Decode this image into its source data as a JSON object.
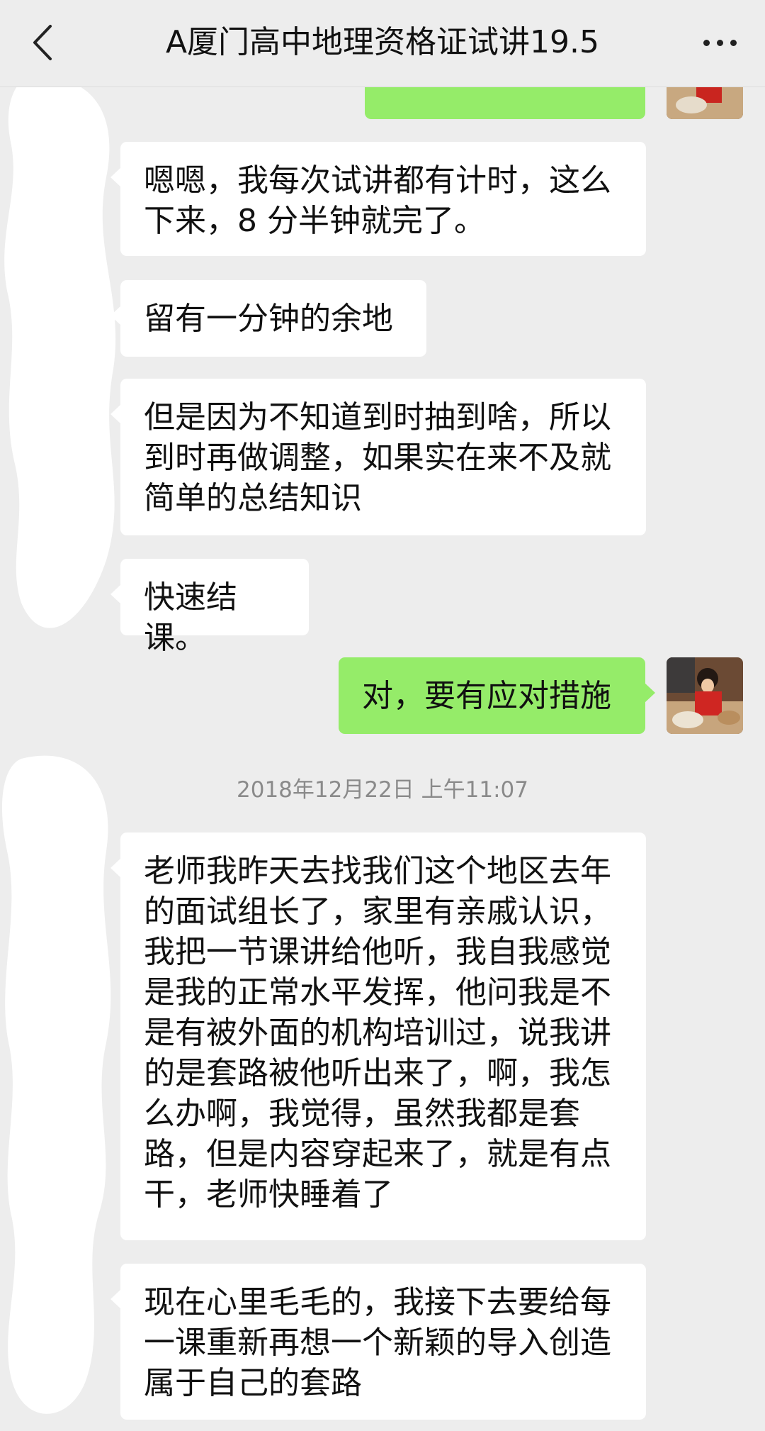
{
  "header": {
    "title": "A厦门高中地理资格证试讲19.5",
    "back_icon": "chevron-left-icon",
    "more_icon": "more-dots-icon"
  },
  "messages": [
    {
      "side": "out",
      "text": ""
    },
    {
      "side": "in",
      "text": "嗯嗯，我每次试讲都有计时，这么下来，8 分半钟就完了。"
    },
    {
      "side": "in",
      "text": "留有一分钟的余地"
    },
    {
      "side": "in",
      "text": "但是因为不知道到时抽到啥，所以到时再做调整，如果实在来不及就简单的总结知识"
    },
    {
      "side": "in",
      "text": "快速结课。"
    },
    {
      "side": "out",
      "text": "对，要有应对措施"
    },
    {
      "side": "in",
      "text": "老师我昨天去找我们这个地区去年的面试组长了，家里有亲戚认识，我把一节课讲给他听，我自我感觉是我的正常水平发挥，他问我是不是有被外面的机构培训过，说我讲的是套路被他听出来了，啊，我怎么办啊，我觉得，虽然我都是套路，但是内容穿起来了，就是有点干，老师快睡着了"
    },
    {
      "side": "in",
      "text": "现在心里毛毛的，我接下去要给每一课重新再想一个新颖的导入创造属于自己的套路"
    }
  ],
  "timestamp": "2018年12月22日 上午11:07",
  "colors": {
    "background": "#ededed",
    "incoming_bubble": "#ffffff",
    "outgoing_bubble": "#95ec69",
    "timestamp_text": "#8a8a8a"
  }
}
